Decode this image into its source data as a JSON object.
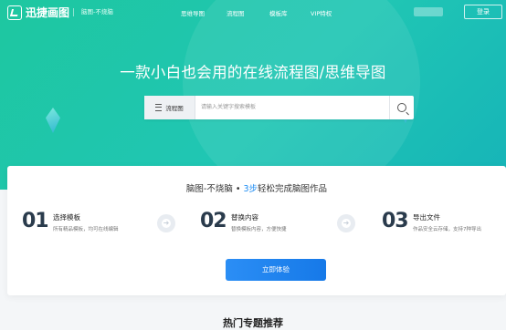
{
  "brand": {
    "name": "迅捷画图",
    "slogan": "脑图-不烧脑"
  },
  "nav": {
    "items": [
      "思维导图",
      "流程图",
      "模板库",
      "VIP特权"
    ],
    "login": "登录"
  },
  "hero": {
    "headline": "一款小白也会用的在线流程图/思维导图"
  },
  "search": {
    "category": "流程图",
    "placeholder": "请输入关键字搜索模板"
  },
  "steps_card": {
    "subtitle_prefix": "脑图-不烧脑 • ",
    "subtitle_highlight": "3步",
    "subtitle_suffix": "轻松完成脑图作品",
    "steps": [
      {
        "num": "01",
        "title": "选择模板",
        "desc": "所有精品模板，均可在线编辑"
      },
      {
        "num": "02",
        "title": "替换内容",
        "desc": "替换模板内容，方便快捷"
      },
      {
        "num": "03",
        "title": "导出文件",
        "desc": "作品安全云存储，支持7种导出"
      }
    ],
    "cta": "立即体验"
  },
  "section": {
    "title": "热门专题推荐"
  },
  "colors": {
    "accent": "#1ec7a0",
    "button": "#1f8df3"
  },
  "icons": {
    "search": "search-icon",
    "category": "menu-icon",
    "arrow": "arrow-right-icon"
  }
}
